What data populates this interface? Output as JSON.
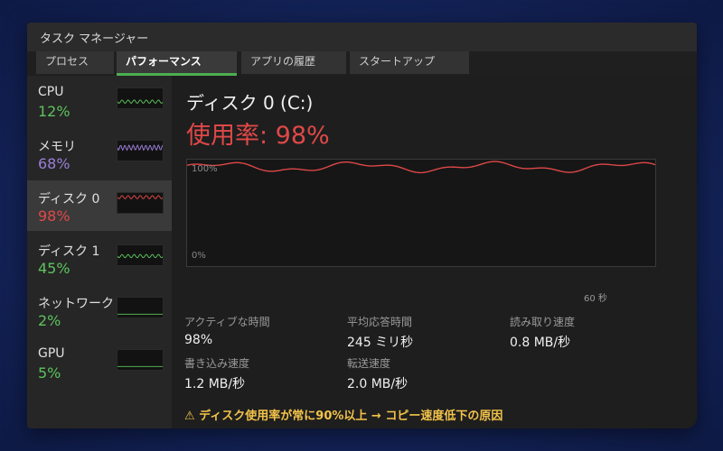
{
  "window": {
    "title": "タスク マネージャー"
  },
  "tabs": [
    {
      "label": "プロセス"
    },
    {
      "label": "パフォーマンス"
    },
    {
      "label": "アプリの履歴"
    },
    {
      "label": "スタートアップ"
    }
  ],
  "sidebar": {
    "items": [
      {
        "name": "CPU",
        "value": "12%",
        "color": "#5cc35c",
        "level": 0.12
      },
      {
        "name": "メモリ",
        "value": "68%",
        "color": "#9b7fd8",
        "level": 0.68
      },
      {
        "name": "ディスク 0",
        "value": "98%",
        "color": "#e04848",
        "level": 0.98
      },
      {
        "name": "ディスク 1",
        "value": "45%",
        "color": "#5cc35c",
        "level": 0.45
      },
      {
        "name": "ネットワーク",
        "value": "2%",
        "color": "#5cc35c",
        "level": 0.02
      },
      {
        "name": "GPU",
        "value": "5%",
        "color": "#5cc35c",
        "level": 0.05
      }
    ]
  },
  "main": {
    "title": "ディスク 0 (C:)",
    "usage_text": "使用率: 98%",
    "graph": {
      "top_label": "100%",
      "bottom_label": "0%",
      "time_label": "60 秒",
      "line_color": "#e04848",
      "range_percent": [
        0,
        100
      ]
    },
    "stats": [
      {
        "label": "アクティブな時間",
        "value": "98%"
      },
      {
        "label": "平均応答時間",
        "value": "245 ミリ秒"
      },
      {
        "label": "読み取り速度",
        "value": "0.8 MB/秒"
      },
      {
        "label": "書き込み速度",
        "value": "1.2 MB/秒"
      },
      {
        "label": "転送速度",
        "value": "2.0 MB/秒"
      }
    ],
    "warning": "⚠ ディスク使用率が常に90%以上 → コピー速度低下の原因"
  }
}
